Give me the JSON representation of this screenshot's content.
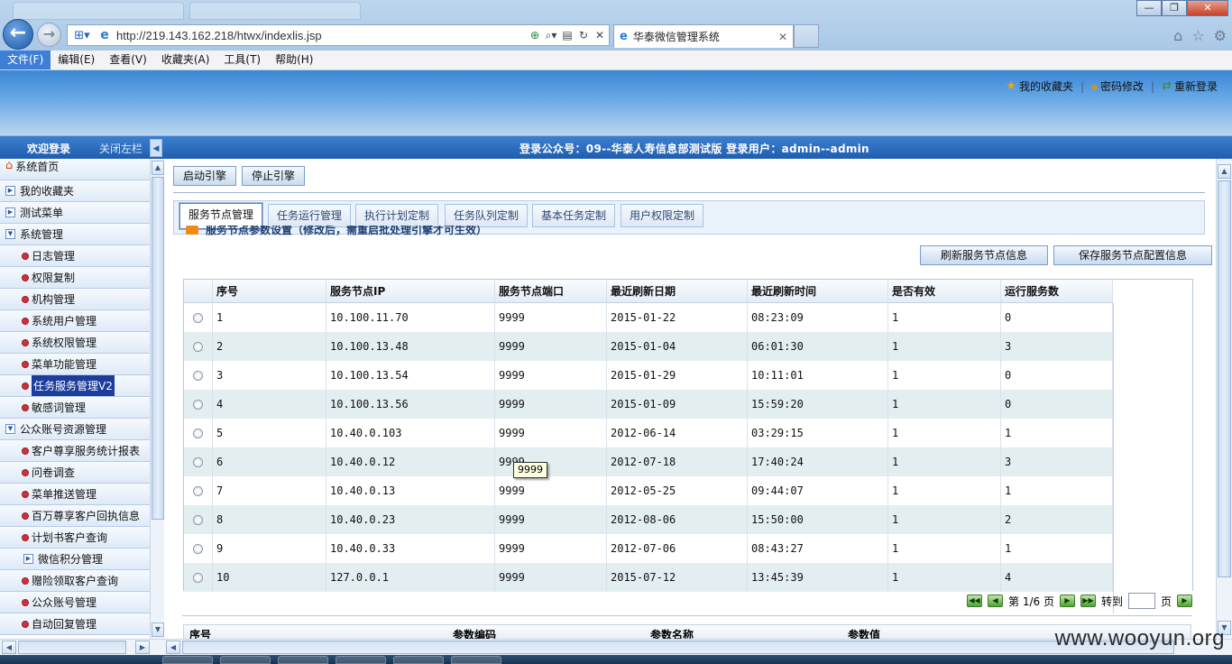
{
  "browser": {
    "url": "http://219.143.162.218/htwx/indexlis.jsp",
    "tab_title": "华泰微信管理系统",
    "menu": [
      "文件(F)",
      "编辑(E)",
      "查看(V)",
      "收藏夹(A)",
      "工具(T)",
      "帮助(H)"
    ]
  },
  "header": {
    "links": [
      "我的收藏夹",
      "密码修改",
      "重新登录"
    ]
  },
  "info_bar": {
    "welcome": "欢迎登录",
    "close_left": "关闭左栏",
    "login_info": "登录公众号：09--华泰人寿信息部测试版 登录用户：admin--admin"
  },
  "sidebar": {
    "items": [
      {
        "label": "系统首页"
      },
      {
        "label": "我的收藏夹"
      },
      {
        "label": "测试菜单"
      },
      {
        "label": "系统管理"
      },
      {
        "label": "日志管理"
      },
      {
        "label": "权限复制"
      },
      {
        "label": "机构管理"
      },
      {
        "label": "系统用户管理"
      },
      {
        "label": "系统权限管理"
      },
      {
        "label": "菜单功能管理"
      },
      {
        "label": "任务服务管理V2"
      },
      {
        "label": "敏感词管理"
      },
      {
        "label": "公众账号资源管理"
      },
      {
        "label": "客户尊享服务统计报表"
      },
      {
        "label": "问卷调查"
      },
      {
        "label": "菜单推送管理"
      },
      {
        "label": "百万尊享客户回执信息"
      },
      {
        "label": "计划书客户查询"
      },
      {
        "label": "微信积分管理"
      },
      {
        "label": "赠险领取客户查询"
      },
      {
        "label": "公众账号管理"
      },
      {
        "label": "自动回复管理"
      }
    ]
  },
  "engine": {
    "start": "启动引擎",
    "stop": "停止引擎"
  },
  "tabs": [
    "服务节点管理",
    "任务运行管理",
    "执行计划定制",
    "任务队列定制",
    "基本任务定制",
    "用户权限定制"
  ],
  "section": {
    "title": "服务节点参数设置（修改后，需重启批处理引擎才可生效）"
  },
  "actions": {
    "refresh": "刷新服务节点信息",
    "save": "保存服务节点配置信息"
  },
  "grid": {
    "columns": [
      "序号",
      "服务节点IP",
      "服务节点端口",
      "最近刷新日期",
      "最近刷新时间",
      "是否有效",
      "运行服务数"
    ],
    "rows": [
      [
        "1",
        "10.100.11.70",
        "9999",
        "2015-01-22",
        "08:23:09",
        "1",
        "0"
      ],
      [
        "2",
        "10.100.13.48",
        "9999",
        "2015-01-04",
        "06:01:30",
        "1",
        "3"
      ],
      [
        "3",
        "10.100.13.54",
        "9999",
        "2015-01-29",
        "10:11:01",
        "1",
        "0"
      ],
      [
        "4",
        "10.100.13.56",
        "9999",
        "2015-01-09",
        "15:59:20",
        "1",
        "0"
      ],
      [
        "5",
        "10.40.0.103",
        "9999",
        "2012-06-14",
        "03:29:15",
        "1",
        "1"
      ],
      [
        "6",
        "10.40.0.12",
        "9999",
        "2012-07-18",
        "17:40:24",
        "1",
        "3"
      ],
      [
        "7",
        "10.40.0.13",
        "9999",
        "2012-05-25",
        "09:44:07",
        "1",
        "1"
      ],
      [
        "8",
        "10.40.0.23",
        "9999",
        "2012-08-06",
        "15:50:00",
        "1",
        "2"
      ],
      [
        "9",
        "10.40.0.33",
        "9999",
        "2012-07-06",
        "08:43:27",
        "1",
        "1"
      ],
      [
        "10",
        "127.0.0.1",
        "9999",
        "2015-07-12",
        "13:45:39",
        "1",
        "4"
      ]
    ],
    "tooltip": "9999"
  },
  "pager": {
    "page_info": "第 1/6 页",
    "goto": "转到",
    "page_suffix": "页"
  },
  "param_grid": {
    "columns": [
      "序号",
      "参数编码",
      "参数名称",
      "参数值"
    ]
  },
  "watermark": "www.wooyun.org"
}
